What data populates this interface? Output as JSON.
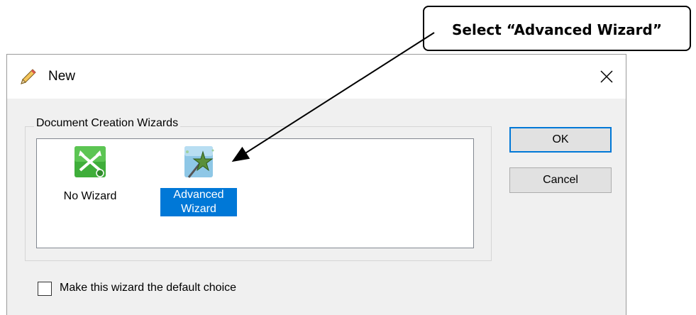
{
  "callout": {
    "text": "Select “Advanced Wizard”"
  },
  "dialog": {
    "title": "New",
    "title_icon": "pencil-icon",
    "close_icon": "close-icon",
    "group_label": "Document Creation Wizards",
    "items": [
      {
        "label": "No Wizard",
        "icon": "no-wizard-icon",
        "selected": false
      },
      {
        "label_line1": "Advanced",
        "label_line2": "Wizard",
        "icon": "magic-wand-star-icon",
        "selected": true
      }
    ],
    "ok_label": "OK",
    "cancel_label": "Cancel",
    "checkbox_label": "Make this wizard the default choice",
    "checkbox_checked": false
  },
  "colors": {
    "selection": "#0078d7",
    "dialog_bg": "#f0f0f0",
    "no_wizard_icon": "#3fae3a"
  }
}
